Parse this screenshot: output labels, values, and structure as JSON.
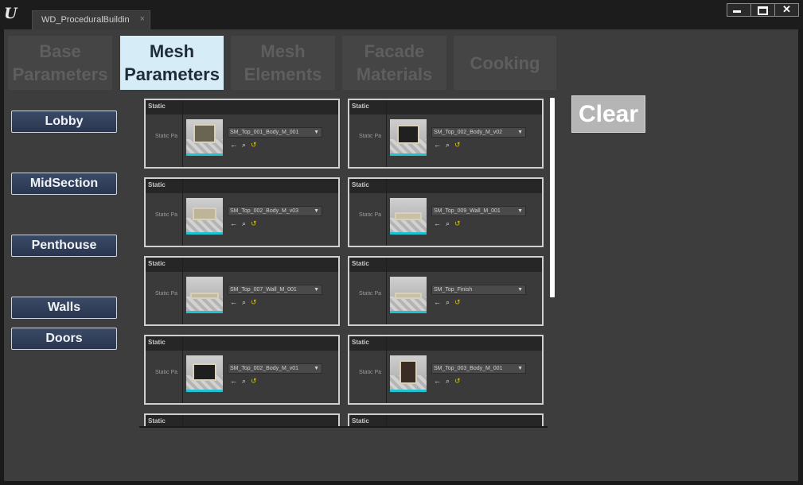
{
  "window": {
    "logo": "U",
    "tab_title": "WD_ProceduralBuildin",
    "close_tab": "×"
  },
  "tabs": [
    {
      "label": "Base Parameters"
    },
    {
      "label": "Mesh Parameters"
    },
    {
      "label": "Mesh Elements"
    },
    {
      "label": "Facade Materials"
    },
    {
      "label": "Cooking"
    }
  ],
  "active_tab": "Mesh Parameters",
  "sidebar": [
    {
      "label": "Lobby"
    },
    {
      "label": "MidSection"
    },
    {
      "label": "Penthouse"
    },
    {
      "label": "Walls"
    },
    {
      "label": "Doors"
    }
  ],
  "clear_label": "Clear",
  "card_header": "Static",
  "card_prop": "Static Pa",
  "icons": {
    "back": "←",
    "search": "⌕",
    "reset": "↺"
  },
  "meshes": [
    {
      "name": "SM_Top_001_Body_M_001"
    },
    {
      "name": "SM_Top_002_Body_M_v02"
    },
    {
      "name": "SM_Top_002_Body_M_v03"
    },
    {
      "name": "SM_Top_009_Wall_M_001"
    },
    {
      "name": "SM_Top_007_Wall_M_001"
    },
    {
      "name": "SM_Top_Finish"
    },
    {
      "name": "SM_Top_002_Body_M_v01"
    },
    {
      "name": "SM_Top_003_Body_M_001"
    },
    {
      "name": ""
    },
    {
      "name": ""
    }
  ],
  "colors": {
    "accent": "#1ec2d0",
    "active_tab": "#d6ecf7",
    "button": "#2a3650"
  }
}
